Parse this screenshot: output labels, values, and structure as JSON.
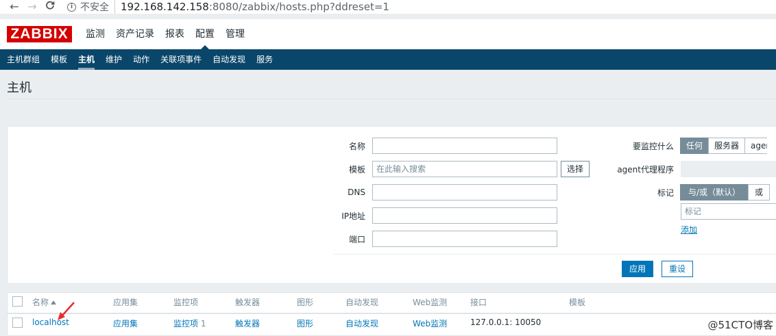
{
  "browser": {
    "back": "←",
    "forward": "→",
    "reload": "C",
    "insecure_label": "不安全",
    "url_host": "192.168.142.158",
    "url_rest": ":8080/zabbix/hosts.php?ddreset=1"
  },
  "logo": "ZABBIX",
  "topmenu": [
    {
      "label": "监测"
    },
    {
      "label": "资产记录"
    },
    {
      "label": "报表"
    },
    {
      "label": "配置"
    },
    {
      "label": "管理"
    }
  ],
  "submenu": [
    {
      "label": "主机群组"
    },
    {
      "label": "模板"
    },
    {
      "label": "主机"
    },
    {
      "label": "维护"
    },
    {
      "label": "动作"
    },
    {
      "label": "关联项事件"
    },
    {
      "label": "自动发现"
    },
    {
      "label": "服务"
    }
  ],
  "page_title": "主机",
  "filter": {
    "name_label": "名称",
    "name_value": "",
    "template_label": "模板",
    "template_placeholder": "在此输入搜索",
    "select_btn": "选择",
    "dns_label": "DNS",
    "ip_label": "IP地址",
    "port_label": "端口",
    "monitored_by_label": "要监控什么",
    "monitored_by_options": [
      "任何",
      "服务器",
      "agen"
    ],
    "proxy_label": "agent代理程序",
    "tags_label": "标记",
    "tags_options": [
      "与/或（默认）",
      "或"
    ],
    "tag_placeholder": "标记",
    "add_link": "添加",
    "apply_btn": "应用",
    "reset_btn": "重设"
  },
  "table": {
    "headers": {
      "name": "名称",
      "applications": "应用集",
      "items": "监控项",
      "triggers": "触发器",
      "graphs": "图形",
      "discovery": "自动发现",
      "web": "Web监测",
      "interface": "接口",
      "templates": "模板"
    },
    "rows": [
      {
        "name": "localhost",
        "applications": "应用集",
        "items": "监控项",
        "items_count": "1",
        "triggers": "触发器",
        "graphs": "图形",
        "discovery": "自动发现",
        "web": "Web监测",
        "interface": "127.0.0.1: 10050"
      }
    ]
  },
  "watermark": "@51CTO博客",
  "colors": {
    "brand_red": "#d40000",
    "submenu_bg": "#0a466a",
    "link_blue": "#0275b8"
  }
}
